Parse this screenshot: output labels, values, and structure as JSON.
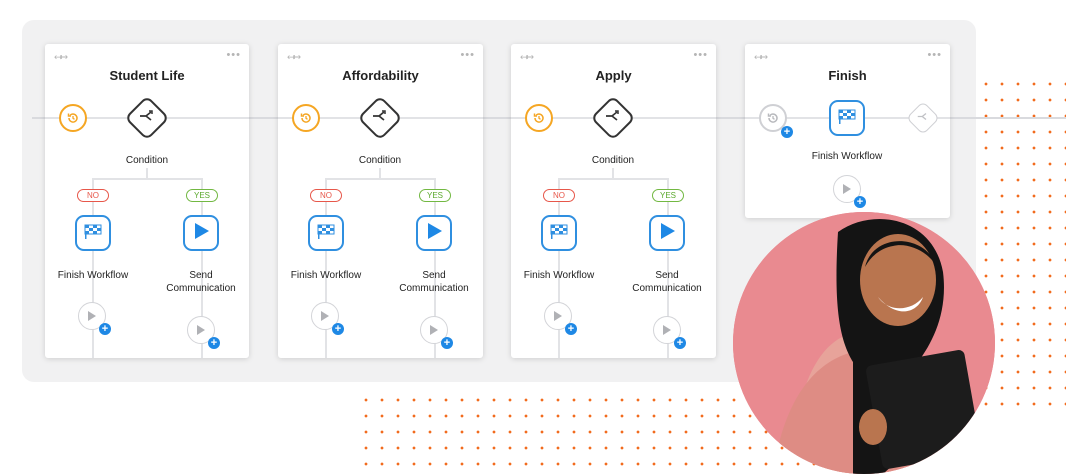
{
  "card_controls": {
    "move": "↤↦",
    "more": "•••"
  },
  "cards": [
    {
      "title": "Student Life",
      "condition": "Condition",
      "no": "NO",
      "yes": "YES",
      "left_action": "Finish Workflow",
      "right_action_line1": "Send",
      "right_action_line2": "Communication"
    },
    {
      "title": "Affordability",
      "condition": "Condition",
      "no": "NO",
      "yes": "YES",
      "left_action": "Finish Workflow",
      "right_action_line1": "Send",
      "right_action_line2": "Communication"
    },
    {
      "title": "Apply",
      "condition": "Condition",
      "no": "NO",
      "yes": "YES",
      "left_action": "Finish Workflow",
      "right_action_line1": "Send",
      "right_action_line2": "Communication"
    }
  ],
  "finish_card": {
    "title": "Finish",
    "action": "Finish Workflow"
  },
  "icons": {
    "delay": "history-icon",
    "condition": "split-icon",
    "finish": "checkered-flag-icon",
    "send": "play-icon",
    "add": "plus-icon"
  },
  "colors": {
    "accent_blue": "#2f8fe0",
    "orange": "#f5a623",
    "no_red": "#e7574a",
    "yes_green": "#72b842",
    "dots": "#f26b1d",
    "photo_bg": "#e9868d"
  },
  "photo": {
    "subject": "person-photo"
  }
}
